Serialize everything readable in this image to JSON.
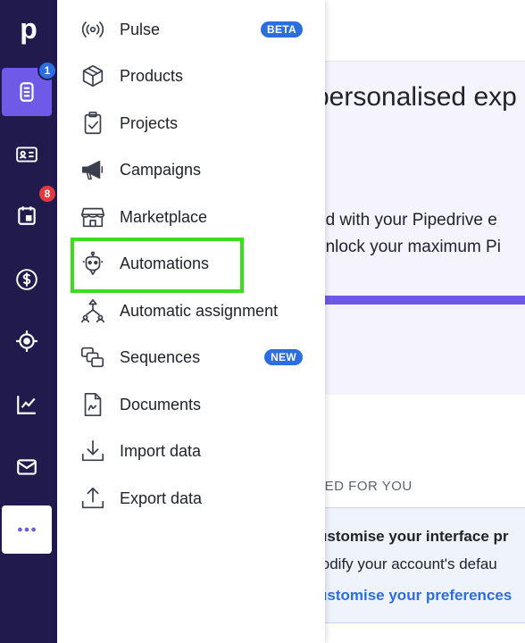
{
  "app": {
    "logo": "p"
  },
  "rail": {
    "items": [
      {
        "name": "deals-icon",
        "badge": "1",
        "badge_color": "#2c6ee0"
      },
      {
        "name": "contacts-icon"
      },
      {
        "name": "activities-icon",
        "badge": "8",
        "badge_color": "#e0393e"
      },
      {
        "name": "dollar-icon"
      },
      {
        "name": "target-icon"
      },
      {
        "name": "insights-icon"
      },
      {
        "name": "mail-icon"
      },
      {
        "name": "more-icon"
      }
    ]
  },
  "menu": {
    "items": [
      {
        "label": "Pulse",
        "tag": "BETA",
        "icon": "pulse-icon"
      },
      {
        "label": "Products",
        "icon": "box-icon"
      },
      {
        "label": "Projects",
        "icon": "clipboard-check-icon"
      },
      {
        "label": "Campaigns",
        "icon": "megaphone-icon"
      },
      {
        "label": "Marketplace",
        "icon": "store-icon"
      },
      {
        "label": "Automations",
        "icon": "robot-icon",
        "highlighted": true
      },
      {
        "label": "Automatic assignment",
        "icon": "assignment-icon"
      },
      {
        "label": "Sequences",
        "tag": "NEW",
        "icon": "sequences-icon"
      },
      {
        "label": "Documents",
        "icon": "document-icon"
      },
      {
        "label": "Import data",
        "icon": "download-icon"
      },
      {
        "label": "Export data",
        "icon": "upload-icon"
      }
    ]
  },
  "page": {
    "hero_title": "personalised exp",
    "hero_line1": "ed with your Pipedrive e",
    "hero_line2": "unlock your maximum Pi",
    "section_label": "TED FOR YOU",
    "card_title": "ustomise your interface pr",
    "card_desc": "lodify your account's defau",
    "card_link": "ustomise your preferences"
  },
  "colors": {
    "rail_bg": "#211a4d",
    "accent": "#6e5ae6",
    "tag_blue": "#2c6ee0",
    "highlight_green": "#3cdc1e"
  }
}
